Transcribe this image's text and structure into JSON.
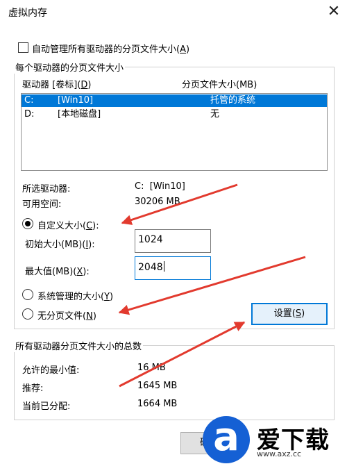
{
  "window": {
    "title": "虚拟内存",
    "close_glyph": "✕"
  },
  "auto_manage": {
    "label_prefix": "自动管理所有驱动器的分页文件大小(",
    "accel": "A",
    "label_suffix": ")",
    "checked": false
  },
  "per_drive_group": {
    "title": "每个驱动器的分页文件大小",
    "col_drive_prefix": "驱动器 [卷标](",
    "col_drive_accel": "D",
    "col_drive_suffix": ")",
    "col_size": "分页文件大小(MB)",
    "drives": [
      {
        "letter": "C:",
        "label": "[Win10]",
        "size": "托管的系统",
        "selected": true
      },
      {
        "letter": "D:",
        "label": "[本地磁盘]",
        "size": "无",
        "selected": false
      }
    ],
    "selected_drive_label": "所选驱动器:",
    "selected_drive_value": "C:  [Win10]",
    "free_space_label": "可用空间:",
    "free_space_value": "30206 MB",
    "custom_size": {
      "prefix": "自定义大小(",
      "accel": "C",
      "suffix": "):",
      "selected": true
    },
    "initial_size": {
      "prefix": "初始大小(MB)(",
      "accel": "I",
      "suffix": "):",
      "value": "1024"
    },
    "max_size": {
      "prefix": "最大值(MB)(",
      "accel": "X",
      "suffix": "):",
      "value": "2048"
    },
    "system_managed": {
      "prefix": "系统管理的大小(",
      "accel": "Y",
      "suffix": ")",
      "selected": false
    },
    "no_paging": {
      "prefix": "无分页文件(",
      "accel": "N",
      "suffix": ")",
      "selected": false
    },
    "set_button": {
      "prefix": "设置(",
      "accel": "S",
      "suffix": ")"
    }
  },
  "totals_group": {
    "title": "所有驱动器分页文件大小的总数",
    "min_label": "允许的最小值:",
    "min_value": "16 MB",
    "recommended_label": "推荐:",
    "recommended_value": "1645 MB",
    "allocated_label": "当前已分配:",
    "allocated_value": "1664 MB"
  },
  "footer": {
    "ok_button": "确定"
  },
  "watermark": {
    "glyph": "a",
    "brand": "爱下载",
    "url": "www.axz.cc"
  },
  "colors": {
    "selection": "#0078d7",
    "arrow": "#e23a2e",
    "logo": "#1560d4"
  }
}
